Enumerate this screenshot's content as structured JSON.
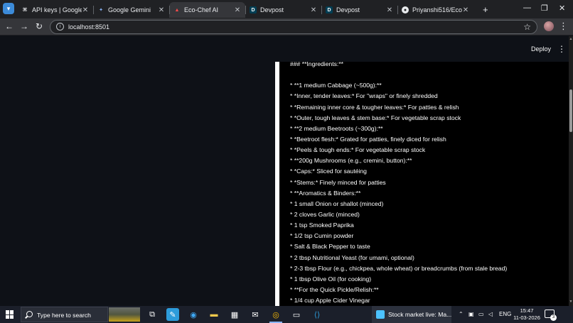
{
  "browser": {
    "tabs": [
      {
        "title": "API keys | Google AI S",
        "favicon": "key-icon",
        "active": false
      },
      {
        "title": "Google Gemini",
        "favicon": "gemini-icon",
        "active": false
      },
      {
        "title": "Eco-Chef AI",
        "favicon": "streamlit-icon",
        "active": true
      },
      {
        "title": "Devpost",
        "favicon": "devpost-icon",
        "active": false
      },
      {
        "title": "Devpost",
        "favicon": "devpost-icon",
        "active": false
      },
      {
        "title": "Priyanshi516/Eco-Che",
        "favicon": "github-icon",
        "active": false
      }
    ],
    "url": "localhost:8501"
  },
  "app": {
    "deploy_label": "Deploy",
    "lines": [
      "### **Ingredients:**",
      "",
      "* **1 medium Cabbage (~500g):**",
      "* *Inner, tender leaves:* For \"wraps\" or finely shredded",
      "* *Remaining inner core & tougher leaves:* For patties & relish",
      "* *Outer, tough leaves & stem base:* For vegetable scrap stock",
      "* **2 medium Beetroots (~300g):**",
      "* *Beetroot flesh:* Grated for patties, finely diced for relish",
      "* *Peels & tough ends:* For vegetable scrap stock",
      "* **200g Mushrooms (e.g., cremini, button):**",
      "* *Caps:* Sliced for sautéing",
      "* *Stems:* Finely minced for patties",
      "* **Aromatics & Binders:**",
      "* 1 small Onion or shallot (minced)",
      "* 2 cloves Garlic (minced)",
      "* 1 tsp Smoked Paprika",
      "* 1/2 tsp Cumin powder",
      "* Salt & Black Pepper to taste",
      "* 2 tbsp Nutritional Yeast (for umami, optional)",
      "* 2-3 tbsp Flour (e.g., chickpea, whole wheat) or breadcrumbs (from stale bread)",
      "* 1 tbsp Olive Oil (for cooking)",
      "* **For the Quick Pickle/Relish:**",
      "* 1/4 cup Apple Cider Vinegar"
    ]
  },
  "taskbar": {
    "search_placeholder": "Type here to search",
    "running_app_label": "Stock market live: Ma...",
    "language": "ENG",
    "time": "15:47",
    "date": "11-03-2026",
    "notification_count": "3"
  },
  "colors": {
    "app_background": "#0e1117",
    "content_background": "#000000",
    "active_tab": "#35363a",
    "streamlit_accent": "#ff4b4b"
  }
}
